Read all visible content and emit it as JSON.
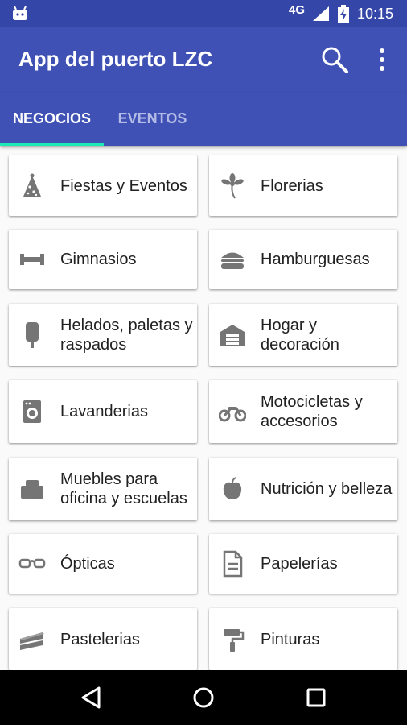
{
  "status_bar": {
    "network": "4G",
    "time": "10:15"
  },
  "app_bar": {
    "title": "App del puerto LZC"
  },
  "tabs": [
    {
      "label": "NEGOCIOS",
      "selected": true
    },
    {
      "label": "EVENTOS",
      "selected": false
    }
  ],
  "categories": [
    {
      "label": "Fiestas y Eventos",
      "icon": "party-hat-icon"
    },
    {
      "label": "Florerias",
      "icon": "flower-icon"
    },
    {
      "label": "Gimnasios",
      "icon": "dumbbell-icon"
    },
    {
      "label": "Hamburguesas",
      "icon": "burger-icon"
    },
    {
      "label": "Helados, paletas y raspados",
      "icon": "popsicle-icon"
    },
    {
      "label": "Hogar y decoración",
      "icon": "garage-icon"
    },
    {
      "label": "Lavanderias",
      "icon": "washing-machine-icon"
    },
    {
      "label": "Motocicletas y accesorios",
      "icon": "motorcycle-icon"
    },
    {
      "label": "Muebles para oficina y escuelas",
      "icon": "armchair-icon"
    },
    {
      "label": "Nutrición y belleza",
      "icon": "apple-icon"
    },
    {
      "label": "Ópticas",
      "icon": "glasses-icon"
    },
    {
      "label": "Papelerías",
      "icon": "document-icon"
    },
    {
      "label": "Pastelerias",
      "icon": "cake-slice-icon"
    },
    {
      "label": "Pinturas",
      "icon": "paint-roller-icon"
    }
  ],
  "colors": {
    "status_bar": "#3446a8",
    "primary": "#3f51b5",
    "tab_indicator": "#1de9b6",
    "icon_gray": "#757575"
  }
}
